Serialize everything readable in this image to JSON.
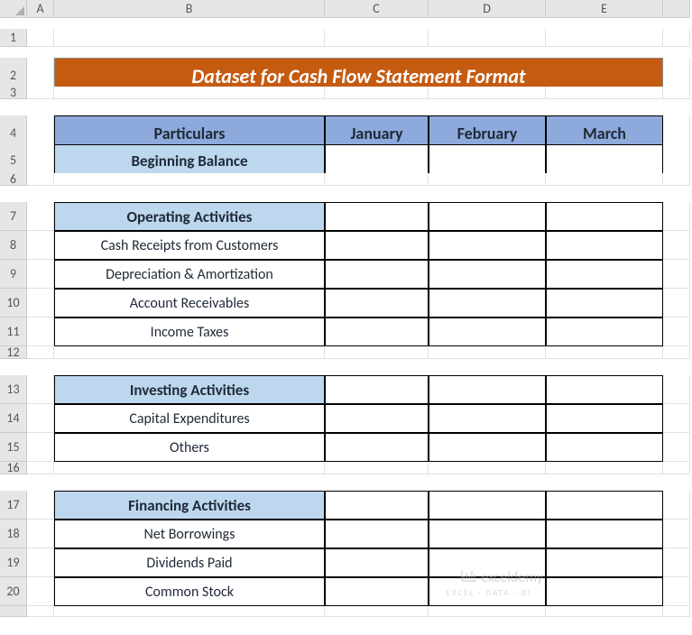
{
  "columns": [
    "A",
    "B",
    "C",
    "D",
    "E"
  ],
  "rows": [
    "1",
    "2",
    "3",
    "4",
    "5",
    "6",
    "7",
    "8",
    "9",
    "10",
    "11",
    "12",
    "13",
    "14",
    "15",
    "16",
    "17",
    "18",
    "19",
    "20"
  ],
  "title": "Dataset for Cash Flow Statement Format",
  "headers": {
    "particulars": "Particulars",
    "jan": "January",
    "feb": "February",
    "mar": "March"
  },
  "sections": {
    "beginning": "Beginning Balance",
    "operating": "Operating Activities",
    "investing": "Investing Activities",
    "financing": "Financing Activities"
  },
  "items": {
    "cash_receipts": "Cash Receipts from Customers",
    "depreciation": "Depreciation & Amortization",
    "account_recv": "Account Receivables",
    "income_tax": "Income Taxes",
    "capex": "Capital Expenditures",
    "others": "Others",
    "net_borrow": "Net Borrowings",
    "dividends": "Dividends Paid",
    "common_stock": "Common Stock"
  },
  "watermark": {
    "brand": "exceldemy",
    "tagline": "EXCEL · DATA · BI"
  },
  "chart_data": {
    "type": "table",
    "title": "Dataset for Cash Flow Statement Format",
    "columns": [
      "Particulars",
      "January",
      "February",
      "March"
    ],
    "rows": [
      {
        "label": "Beginning Balance",
        "style": "section",
        "values": [
          "",
          "",
          ""
        ]
      },
      {
        "label": "Operating Activities",
        "style": "section",
        "values": [
          "",
          "",
          ""
        ]
      },
      {
        "label": "Cash Receipts from Customers",
        "style": "item",
        "values": [
          "",
          "",
          ""
        ]
      },
      {
        "label": "Depreciation & Amortization",
        "style": "item",
        "values": [
          "",
          "",
          ""
        ]
      },
      {
        "label": "Account Receivables",
        "style": "item",
        "values": [
          "",
          "",
          ""
        ]
      },
      {
        "label": "Income Taxes",
        "style": "item",
        "values": [
          "",
          "",
          ""
        ]
      },
      {
        "label": "Investing Activities",
        "style": "section",
        "values": [
          "",
          "",
          ""
        ]
      },
      {
        "label": "Capital Expenditures",
        "style": "item",
        "values": [
          "",
          "",
          ""
        ]
      },
      {
        "label": "Others",
        "style": "item",
        "values": [
          "",
          "",
          ""
        ]
      },
      {
        "label": "Financing Activities",
        "style": "section",
        "values": [
          "",
          "",
          ""
        ]
      },
      {
        "label": "Net Borrowings",
        "style": "item",
        "values": [
          "",
          "",
          ""
        ]
      },
      {
        "label": "Dividends Paid",
        "style": "item",
        "values": [
          "",
          "",
          ""
        ]
      },
      {
        "label": "Common Stock",
        "style": "item",
        "values": [
          "",
          "",
          ""
        ]
      }
    ]
  }
}
